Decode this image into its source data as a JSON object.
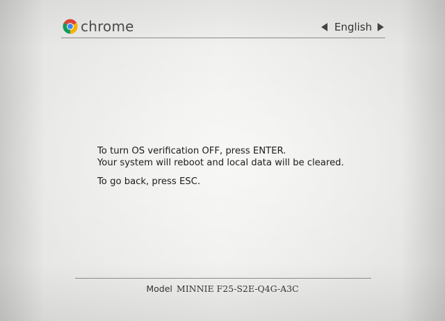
{
  "header": {
    "brand": "chrome",
    "language": "English"
  },
  "icons": {
    "brand_logo": "chrome-logo-icon",
    "language_prev": "triangle-left-icon",
    "language_next": "triangle-right-icon"
  },
  "message": {
    "line1": "To turn OS verification OFF, press ENTER.",
    "line2": "Your system will reboot and local data will be cleared.",
    "line3": "To go back, press ESC."
  },
  "footer": {
    "model_label": "Model",
    "model_value": "MINNIE F25-S2E-Q4G-A3C"
  },
  "colors": {
    "background": "#ececea",
    "text": "#1c1c1c",
    "rule": "#8a8a8a",
    "chrome_red": "#db4437",
    "chrome_green": "#0f9d58",
    "chrome_yellow": "#f4b400",
    "chrome_blue": "#4285f4"
  }
}
